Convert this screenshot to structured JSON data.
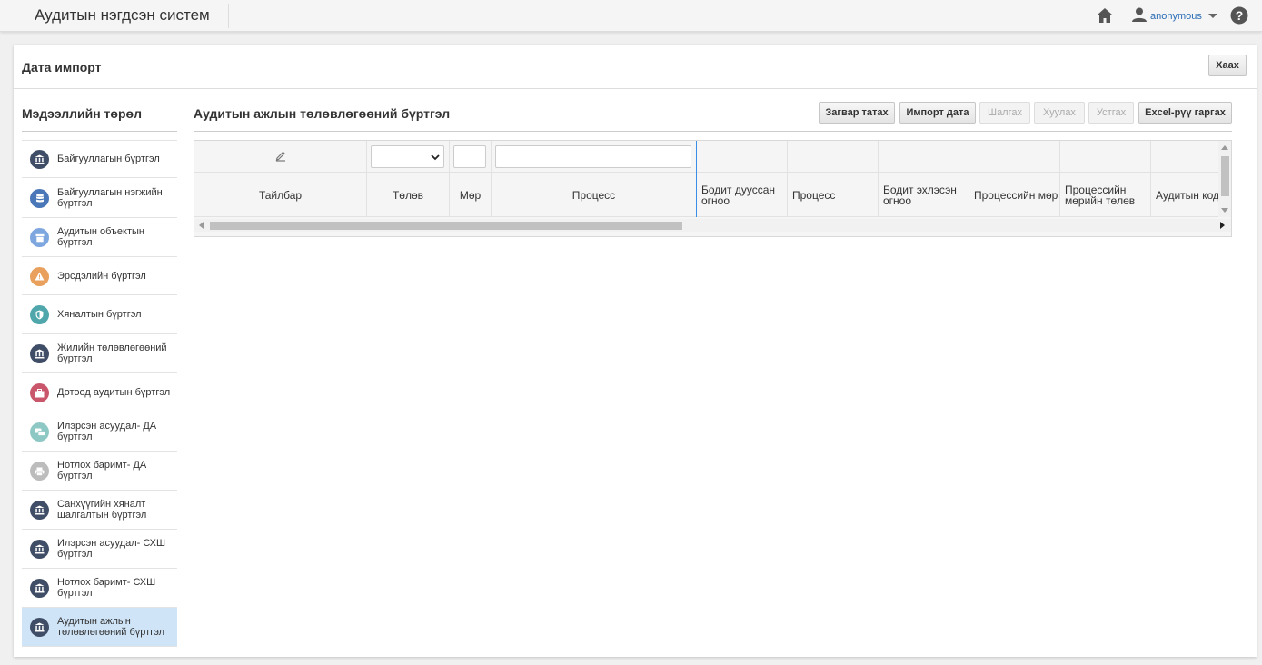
{
  "app": {
    "title": "Аудитын нэгдсэн систем"
  },
  "topnav": {
    "home_icon": "home-icon",
    "user_icon": "person-icon",
    "username": "anonymous",
    "help_icon": "help-circle-icon"
  },
  "page": {
    "title": "Дата импорт",
    "close_label": "Хаах"
  },
  "sidebar": {
    "title": "Мэдээллийн төрөл",
    "items": [
      {
        "label": "Байгууллагын бүртгэл",
        "icon": "bank-icon",
        "color": "#3f4e66",
        "active": false
      },
      {
        "label": "Байгууллагын нэгжийн бүртгэл",
        "icon": "database-icon",
        "color": "#4a77b8",
        "active": false
      },
      {
        "label": "Аудитын объектын бүртгэл",
        "icon": "archive-icon",
        "color": "#7ea6df",
        "active": false
      },
      {
        "label": "Эрсдэлийн бүртгэл",
        "icon": "warning-icon",
        "color": "#e8a05c",
        "active": false
      },
      {
        "label": "Хяналтын бүртгэл",
        "icon": "shield-icon",
        "color": "#4fa6ab",
        "active": false
      },
      {
        "label": "Жилийн төлөвлөгөөний бүртгэл",
        "icon": "bank-icon",
        "color": "#3f4e66",
        "active": false
      },
      {
        "label": "Дотоод аудитын бүртгэл",
        "icon": "briefcase-icon",
        "color": "#c9566a",
        "active": false
      },
      {
        "label": "Илэрсэн асуудал- ДА бүртгэл",
        "icon": "chat-icon",
        "color": "#8ec8c4",
        "active": false
      },
      {
        "label": "Нотлох баримт- ДА бүртгэл",
        "icon": "printer-icon",
        "color": "#bcbcbc",
        "active": false
      },
      {
        "label": "Санхүүгийн хяналт шалгалтын бүртгэл",
        "icon": "bank-icon",
        "color": "#3f4e66",
        "active": false
      },
      {
        "label": "Илэрсэн асуудал- СХШ бүртгэл",
        "icon": "bank-icon",
        "color": "#3f4e66",
        "active": false
      },
      {
        "label": "Нотлох баримт- СХШ бүртгэл",
        "icon": "bank-icon",
        "color": "#3f4e66",
        "active": false
      },
      {
        "label": "Аудитын ажлын төлөвлөгөөний бүртгэл",
        "icon": "bank-icon",
        "color": "#3f4e66",
        "active": true
      }
    ]
  },
  "main": {
    "title": "Аудитын ажлын төлөвлөгөөний бүртгэл",
    "toolbar": {
      "template_label": "Загвар татах",
      "import_label": "Импорт дата",
      "check_label": "Шалгах",
      "copy_label": "Хуулах",
      "delete_label": "Устгах",
      "excel_label": "Excel-рүү гаргах"
    },
    "grid": {
      "columns": [
        {
          "label": "Тайлбар"
        },
        {
          "label": "Төлөв"
        },
        {
          "label": "Мөр"
        },
        {
          "label": "Процесс"
        },
        {
          "label": "Бодит дууссан огноо"
        },
        {
          "label": "Процесс"
        },
        {
          "label": "Бодит эхлэсэн огноо"
        },
        {
          "label": "Процессийн мөр"
        },
        {
          "label": "Процессийн мөрийн төлөв"
        },
        {
          "label": "Аудитын код"
        }
      ],
      "filters": {
        "status_value": "",
        "row_value": "",
        "process_value": ""
      },
      "edit_icon": "pencil-icon"
    }
  }
}
